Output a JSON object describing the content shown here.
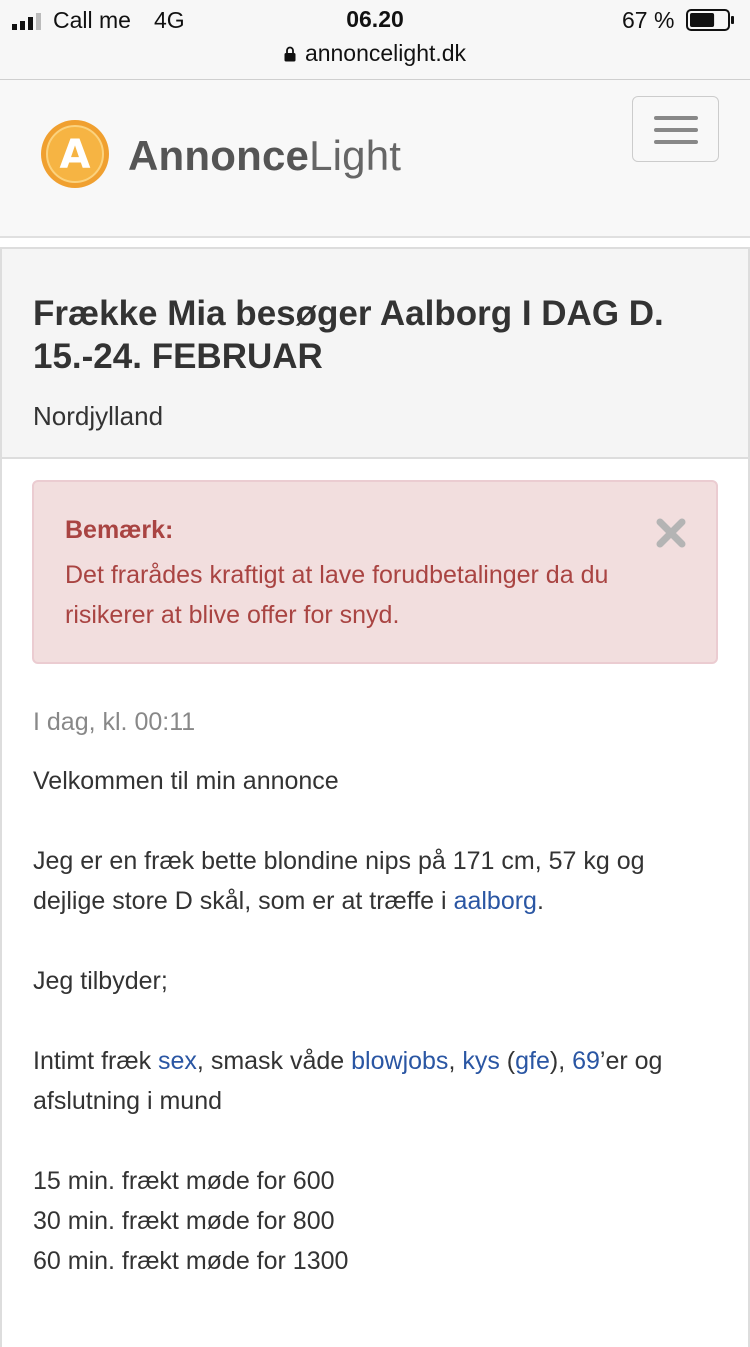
{
  "status_bar": {
    "carrier": "Call me",
    "network": "4G",
    "time": "06.20",
    "battery": "67 %",
    "battery_level": 0.67
  },
  "browser": {
    "url": "annoncelight.dk"
  },
  "header": {
    "logo_letter": "A",
    "logo_bold": "Annonce",
    "logo_light": "Light"
  },
  "ad": {
    "title": "Frække Mia besøger Aalborg I DAG D. 15.-24. FEBRUAR",
    "region": "Nordjylland",
    "posted": "I dag, kl. 00:11"
  },
  "notice": {
    "title": "Bemærk:",
    "text": "Det frarådes kraftigt at lave forudbetalinger da du risikerer at blive offer for snyd.",
    "close_symbol": "✖"
  },
  "content": {
    "welcome": "Velkommen til min annonce",
    "intro_before": "Jeg er en fræk bette blondine nips på 171 cm, 57 kg og dejlige store D skål, som er at træffe i ",
    "intro_link": "aalborg",
    "intro_after": ".",
    "offers_heading": "Jeg tilbyder;",
    "services_1": "Intimt fræk ",
    "link_sex": "sex",
    "services_2": ", smask våde ",
    "link_blowjobs": "blowjobs",
    "services_3": ", ",
    "link_kys": "kys",
    "services_4": " (",
    "link_gfe": "gfe",
    "services_5": "), ",
    "link_69": "69",
    "services_6": "’er og afslutning i mund",
    "prices": [
      "15 min. frækt møde for 600",
      "30 min. frækt møde for 800",
      "60 min. frækt møde for 1300"
    ]
  },
  "colors": {
    "link": "#2a56a3",
    "alert_text": "#a94442",
    "alert_bg": "#f2dede",
    "logo_orange": "#f0a030"
  }
}
